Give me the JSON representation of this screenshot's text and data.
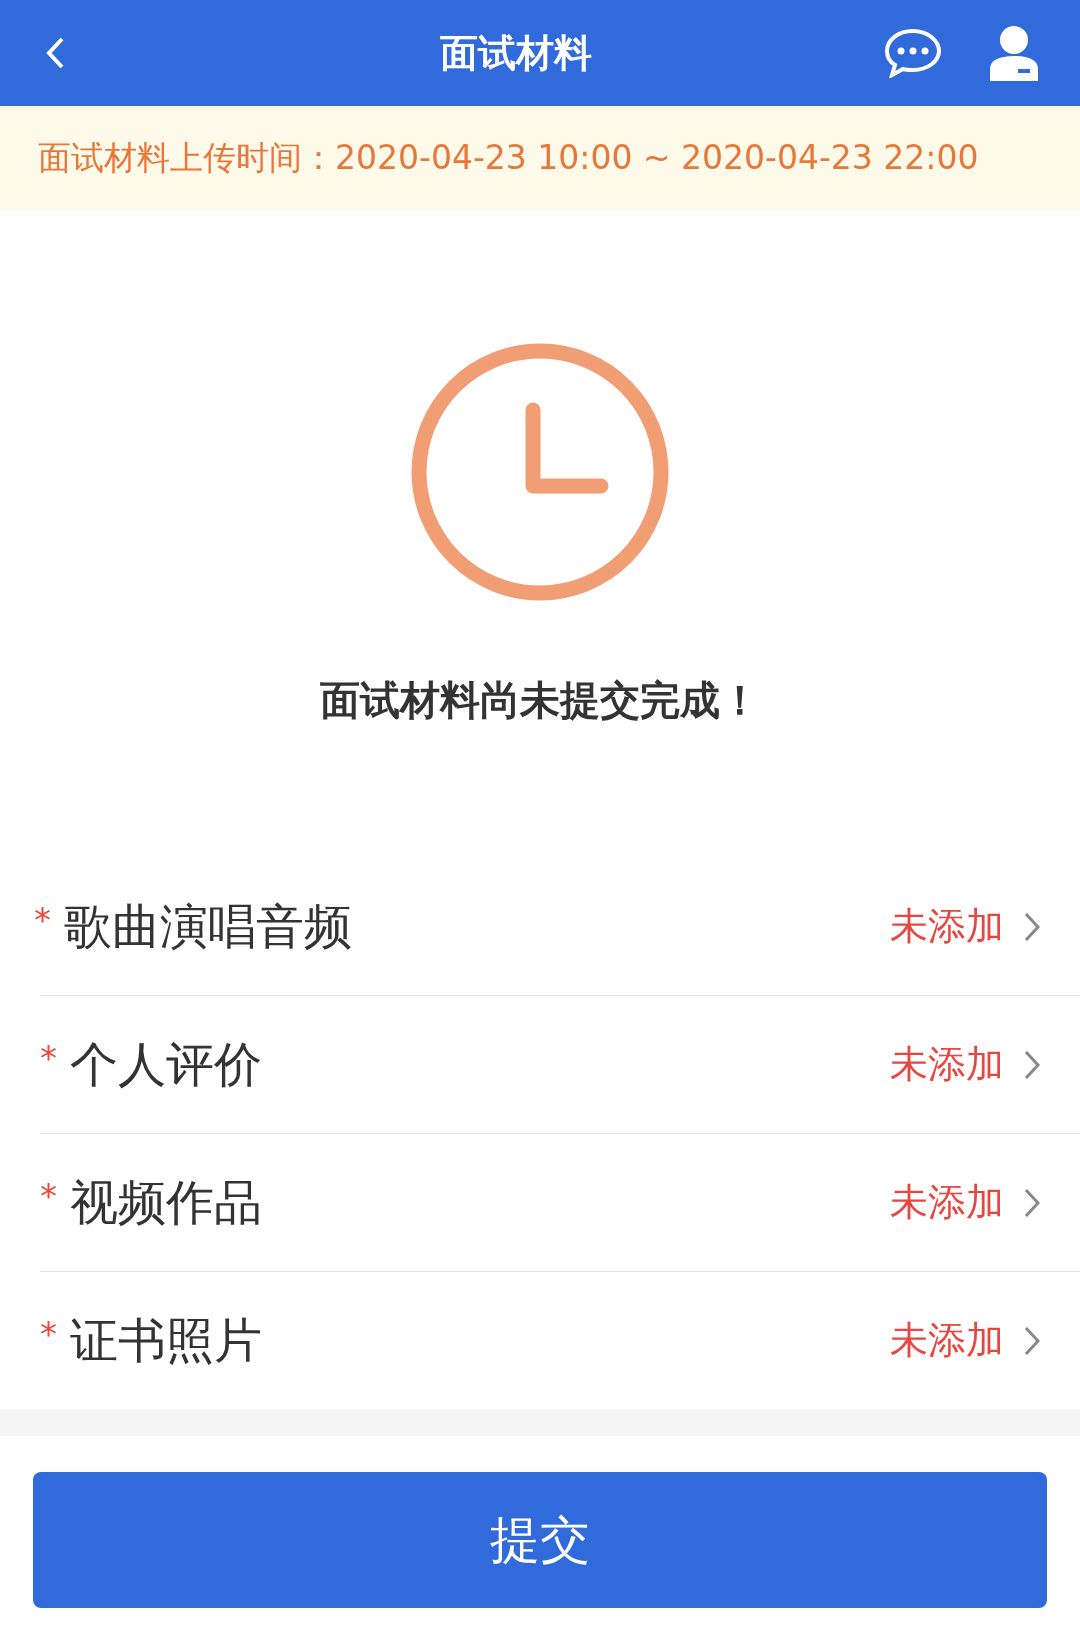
{
  "header": {
    "title": "面试材料"
  },
  "notice": {
    "text": "面试材料上传时间：2020-04-23 10:00 ~ 2020-04-23 22:00"
  },
  "status": {
    "message": "面试材料尚未提交完成！"
  },
  "materials": [
    {
      "mark": "*",
      "label": "歌曲演唱音频",
      "status": "未添加"
    },
    {
      "mark": "*",
      "label": "个人评价",
      "status": "未添加"
    },
    {
      "mark": "*",
      "label": "视频作品",
      "status": "未添加"
    },
    {
      "mark": "*",
      "label": "证书照片",
      "status": "未添加"
    }
  ],
  "submit_button": {
    "label": "提交"
  }
}
